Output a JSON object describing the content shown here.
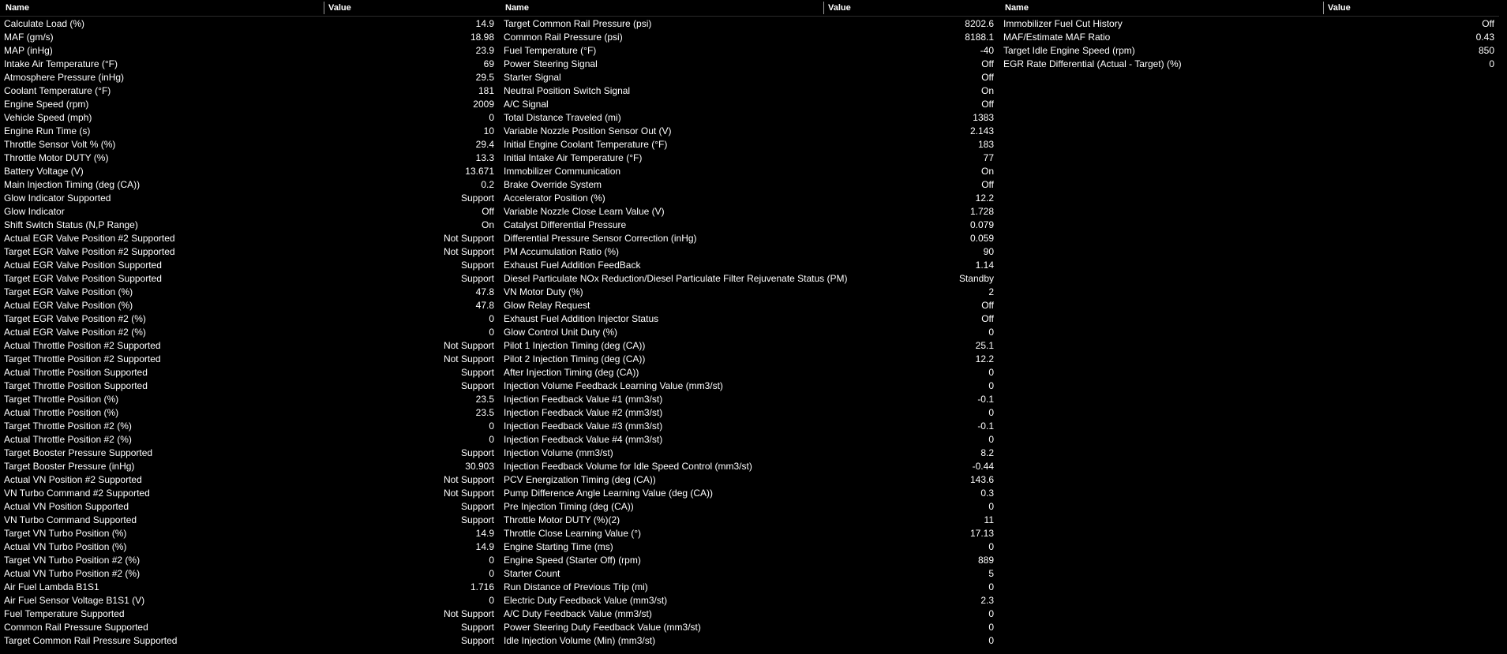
{
  "headers": {
    "name": "Name",
    "value": "Value"
  },
  "colors": {
    "background": "#000000",
    "text": "#ffffff",
    "header_separator": "#9a9a9a"
  },
  "columns": [
    {
      "rows": [
        {
          "name": "Calculate Load (%)",
          "value": "14.9"
        },
        {
          "name": "MAF (gm/s)",
          "value": "18.98"
        },
        {
          "name": "MAP (inHg)",
          "value": "23.9"
        },
        {
          "name": "Intake Air Temperature (°F)",
          "value": "69"
        },
        {
          "name": "Atmosphere Pressure (inHg)",
          "value": "29.5"
        },
        {
          "name": "Coolant Temperature (°F)",
          "value": "181"
        },
        {
          "name": "Engine Speed (rpm)",
          "value": "2009"
        },
        {
          "name": "Vehicle Speed (mph)",
          "value": "0"
        },
        {
          "name": "Engine Run Time (s)",
          "value": "10"
        },
        {
          "name": "Throttle Sensor Volt % (%)",
          "value": "29.4"
        },
        {
          "name": "Throttle Motor DUTY (%)",
          "value": "13.3"
        },
        {
          "name": "Battery Voltage (V)",
          "value": "13.671"
        },
        {
          "name": "Main Injection Timing (deg (CA))",
          "value": "0.2"
        },
        {
          "name": "Glow Indicator Supported",
          "value": "Support"
        },
        {
          "name": "Glow Indicator",
          "value": "Off"
        },
        {
          "name": "Shift Switch Status (N,P Range)",
          "value": "On"
        },
        {
          "name": "Actual EGR Valve Position #2 Supported",
          "value": "Not Support"
        },
        {
          "name": "Target EGR Valve Position #2 Supported",
          "value": "Not Support"
        },
        {
          "name": "Actual EGR Valve Position Supported",
          "value": "Support"
        },
        {
          "name": "Target EGR Valve Position Supported",
          "value": "Support"
        },
        {
          "name": "Target EGR Valve Position (%)",
          "value": "47.8"
        },
        {
          "name": "Actual EGR Valve Position (%)",
          "value": "47.8"
        },
        {
          "name": "Target EGR Valve Position #2 (%)",
          "value": "0"
        },
        {
          "name": "Actual EGR Valve Position #2 (%)",
          "value": "0"
        },
        {
          "name": "Actual Throttle Position #2 Supported",
          "value": "Not Support"
        },
        {
          "name": "Target Throttle Position #2 Supported",
          "value": "Not Support"
        },
        {
          "name": "Actual Throttle Position Supported",
          "value": "Support"
        },
        {
          "name": "Target Throttle Position Supported",
          "value": "Support"
        },
        {
          "name": "Target Throttle Position (%)",
          "value": "23.5"
        },
        {
          "name": "Actual Throttle Position (%)",
          "value": "23.5"
        },
        {
          "name": "Target Throttle Position #2 (%)",
          "value": "0"
        },
        {
          "name": "Actual Throttle Position #2 (%)",
          "value": "0"
        },
        {
          "name": "Target Booster Pressure Supported",
          "value": "Support"
        },
        {
          "name": "Target Booster Pressure (inHg)",
          "value": "30.903"
        },
        {
          "name": "Actual VN Position #2 Supported",
          "value": "Not Support"
        },
        {
          "name": "VN Turbo Command #2 Supported",
          "value": "Not Support"
        },
        {
          "name": "Actual VN Position Supported",
          "value": "Support"
        },
        {
          "name": "VN Turbo Command Supported",
          "value": "Support"
        },
        {
          "name": "Target VN Turbo Position (%)",
          "value": "14.9"
        },
        {
          "name": "Actual VN Turbo Position (%)",
          "value": "14.9"
        },
        {
          "name": "Target VN Turbo Position #2 (%)",
          "value": "0"
        },
        {
          "name": "Actual VN Turbo Position #2 (%)",
          "value": "0"
        },
        {
          "name": "Air Fuel Lambda B1S1",
          "value": "1.716"
        },
        {
          "name": "Air Fuel Sensor Voltage B1S1 (V)",
          "value": "0"
        },
        {
          "name": "Fuel Temperature Supported",
          "value": "Not Support"
        },
        {
          "name": "Common Rail Pressure Supported",
          "value": "Support"
        },
        {
          "name": "Target Common Rail Pressure Supported",
          "value": "Support"
        }
      ]
    },
    {
      "rows": [
        {
          "name": "Target Common Rail Pressure (psi)",
          "value": "8202.6"
        },
        {
          "name": "Common Rail Pressure (psi)",
          "value": "8188.1"
        },
        {
          "name": "Fuel Temperature (°F)",
          "value": "-40"
        },
        {
          "name": "Power Steering Signal",
          "value": "Off"
        },
        {
          "name": "Starter Signal",
          "value": "Off"
        },
        {
          "name": "Neutral Position Switch Signal",
          "value": "On"
        },
        {
          "name": "A/C Signal",
          "value": "Off"
        },
        {
          "name": "Total Distance Traveled (mi)",
          "value": "1383"
        },
        {
          "name": "Variable Nozzle Position Sensor Out (V)",
          "value": "2.143"
        },
        {
          "name": "Initial Engine Coolant Temperature (°F)",
          "value": "183"
        },
        {
          "name": "Initial Intake Air Temperature (°F)",
          "value": "77"
        },
        {
          "name": "Immobilizer Communication",
          "value": "On"
        },
        {
          "name": "Brake Override System",
          "value": "Off"
        },
        {
          "name": "Accelerator Position (%)",
          "value": "12.2"
        },
        {
          "name": "Variable Nozzle Close Learn Value (V)",
          "value": "1.728"
        },
        {
          "name": "Catalyst Differential Pressure",
          "value": "0.079"
        },
        {
          "name": "Differential Pressure Sensor Correction (inHg)",
          "value": "0.059"
        },
        {
          "name": "PM Accumulation Ratio (%)",
          "value": "90"
        },
        {
          "name": "Exhaust Fuel Addition FeedBack",
          "value": "1.14"
        },
        {
          "name": "Diesel Particulate NOx Reduction/Diesel Particulate Filter Rejuvenate Status (PM)",
          "value": "Standby"
        },
        {
          "name": "VN Motor Duty (%)",
          "value": "2"
        },
        {
          "name": "Glow Relay Request",
          "value": "Off"
        },
        {
          "name": "Exhaust Fuel Addition Injector Status",
          "value": "Off"
        },
        {
          "name": "Glow Control Unit Duty (%)",
          "value": "0"
        },
        {
          "name": "Pilot 1 Injection Timing (deg (CA))",
          "value": "25.1"
        },
        {
          "name": "Pilot 2 Injection Timing (deg (CA))",
          "value": "12.2"
        },
        {
          "name": "After Injection Timing (deg (CA))",
          "value": "0"
        },
        {
          "name": "Injection Volume Feedback Learning Value (mm3/st)",
          "value": "0"
        },
        {
          "name": "Injection Feedback Value #1 (mm3/st)",
          "value": "-0.1"
        },
        {
          "name": "Injection Feedback Value #2 (mm3/st)",
          "value": "0"
        },
        {
          "name": "Injection Feedback Value #3 (mm3/st)",
          "value": "-0.1"
        },
        {
          "name": "Injection Feedback Value #4 (mm3/st)",
          "value": "0"
        },
        {
          "name": "Injection Volume (mm3/st)",
          "value": "8.2"
        },
        {
          "name": "Injection Feedback Volume for Idle Speed Control (mm3/st)",
          "value": "-0.44"
        },
        {
          "name": "PCV Energization Timing (deg (CA))",
          "value": "143.6"
        },
        {
          "name": "Pump Difference Angle Learning Value (deg (CA))",
          "value": "0.3"
        },
        {
          "name": "Pre Injection Timing (deg (CA))",
          "value": "0"
        },
        {
          "name": "Throttle Motor DUTY (%)(2)",
          "value": "11"
        },
        {
          "name": "Throttle Close Learning Value (°)",
          "value": "17.13"
        },
        {
          "name": "Engine Starting Time (ms)",
          "value": "0"
        },
        {
          "name": "Engine Speed (Starter Off) (rpm)",
          "value": "889"
        },
        {
          "name": "Starter Count",
          "value": "5"
        },
        {
          "name": "Run Distance of Previous Trip (mi)",
          "value": "0"
        },
        {
          "name": "Electric Duty Feedback Value (mm3/st)",
          "value": "2.3"
        },
        {
          "name": "A/C Duty Feedback Value (mm3/st)",
          "value": "0"
        },
        {
          "name": "Power Steering Duty Feedback Value (mm3/st)",
          "value": "0"
        },
        {
          "name": "Idle Injection Volume (Min) (mm3/st)",
          "value": "0"
        }
      ]
    },
    {
      "rows": [
        {
          "name": "Immobilizer Fuel Cut History",
          "value": "Off"
        },
        {
          "name": "MAF/Estimate MAF Ratio",
          "value": "0.43"
        },
        {
          "name": "Target Idle Engine Speed (rpm)",
          "value": "850"
        },
        {
          "name": "EGR Rate Differential (Actual - Target) (%)",
          "value": "0"
        }
      ]
    }
  ]
}
